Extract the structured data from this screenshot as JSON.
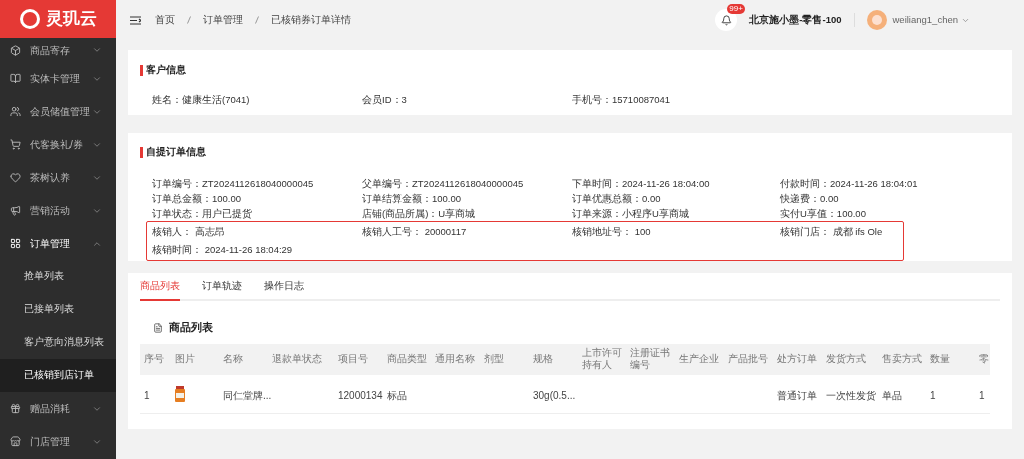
{
  "logo": {
    "text": "灵玑云"
  },
  "sidebar": {
    "items": [
      {
        "label": "商品寄存",
        "expanded": false
      },
      {
        "label": "实体卡管理",
        "expanded": false
      },
      {
        "label": "会员储值管理",
        "expanded": false
      },
      {
        "label": "代客换礼/券",
        "expanded": false
      },
      {
        "label": "茶树认养",
        "expanded": false
      },
      {
        "label": "营销活动",
        "expanded": false
      },
      {
        "label": "订单管理",
        "expanded": true,
        "children": [
          {
            "label": "抢单列表",
            "selected": false
          },
          {
            "label": "已接单列表",
            "selected": false
          },
          {
            "label": "客户意向消息列表",
            "selected": false
          },
          {
            "label": "已核销到店订单",
            "selected": true
          }
        ]
      },
      {
        "label": "赠品消耗",
        "expanded": false
      },
      {
        "label": "门店管理",
        "expanded": false
      }
    ]
  },
  "breadcrumb": [
    "首页",
    "订单管理",
    "已核销券订单详情"
  ],
  "header": {
    "notification_badge": "99+",
    "store": "北京施小墨-零售-100",
    "user": "weiliang1_chen"
  },
  "customer": {
    "title": "客户信息",
    "fields": [
      "姓名：健康生活(7041)",
      "会员ID：3",
      "手机号：15710087041"
    ]
  },
  "order": {
    "title": "自提订单信息",
    "fields": [
      "订单编号：ZT2024112618040000045",
      "父单编号：ZT2024112618040000045",
      "下单时间：2024-11-26 18:04:00",
      "付款时间：2024-11-26 18:04:01",
      "订单总金额：100.00",
      "订单结算金额：100.00",
      "订单优惠总额：0.00",
      "快递费：0.00",
      "订单状态：用户已提货",
      "店铺(商品所属)：U享商城",
      "订单来源：小程序U享商城",
      "实付U享值：100.00"
    ],
    "highlighted_fields": [
      "核销人：  高志昂",
      "核销人工号：  20000117",
      "核销地址号：  100",
      "核销门店：  成都 ifs Ole",
      "核销时间：  2024-11-26 18:04:29"
    ]
  },
  "tabs": [
    {
      "label": "商品列表",
      "selected": true
    },
    {
      "label": "订单轨迹",
      "selected": false
    },
    {
      "label": "操作日志",
      "selected": false
    }
  ],
  "table": {
    "title": "商品列表",
    "columns": [
      "序号",
      "图片",
      "名称",
      "退款单状态",
      "项目号",
      "商品类型",
      "通用名称",
      "剂型",
      "规格",
      "上市许可持有人",
      "注册证书编号",
      "生产企业",
      "产品批号",
      "处方订单",
      "发货方式",
      "售卖方式",
      "数量",
      "零"
    ],
    "rows": [
      {
        "cells": [
          "1",
          {
            "kind": "picture"
          },
          "同仁堂牌...",
          "",
          "12000134",
          "标品",
          "",
          "",
          "30g(0.5...",
          "",
          "",
          "",
          "",
          "普通订单",
          "一次性发货",
          "单品",
          "1",
          "1"
        ]
      }
    ]
  }
}
